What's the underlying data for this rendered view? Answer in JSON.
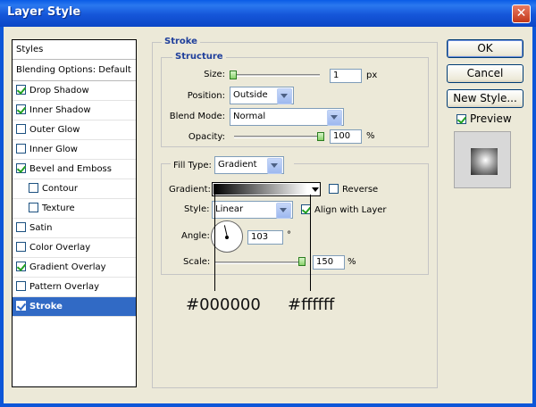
{
  "window": {
    "title": "Layer Style",
    "close_glyph": "✕"
  },
  "styles_list": {
    "header": "Styles",
    "blending": "Blending Options: Default",
    "items": [
      {
        "label": "Drop Shadow",
        "checked": true
      },
      {
        "label": "Inner Shadow",
        "checked": true
      },
      {
        "label": "Outer Glow",
        "checked": false
      },
      {
        "label": "Inner Glow",
        "checked": false
      },
      {
        "label": "Bevel and Emboss",
        "checked": true
      },
      {
        "label": "Contour",
        "checked": false
      },
      {
        "label": "Texture",
        "checked": false
      },
      {
        "label": "Satin",
        "checked": false
      },
      {
        "label": "Color Overlay",
        "checked": false
      },
      {
        "label": "Gradient Overlay",
        "checked": true
      },
      {
        "label": "Pattern Overlay",
        "checked": false
      },
      {
        "label": "Stroke",
        "checked": true
      }
    ]
  },
  "stroke": {
    "section_title": "Stroke",
    "structure_title": "Structure",
    "size_label": "Size:",
    "size_value": "1",
    "size_unit": "px",
    "position_label": "Position:",
    "position_value": "Outside",
    "blend_label": "Blend Mode:",
    "blend_value": "Normal",
    "opacity_label": "Opacity:",
    "opacity_value": "100",
    "opacity_unit": "%",
    "fill_type_label": "Fill Type:",
    "fill_type_value": "Gradient",
    "gradient_label": "Gradient:",
    "reverse_label": "Reverse",
    "reverse_checked": false,
    "style_label": "Style:",
    "style_value": "Linear",
    "align_label": "Align with Layer",
    "align_checked": true,
    "angle_label": "Angle:",
    "angle_value": "103",
    "angle_unit": "°",
    "scale_label": "Scale:",
    "scale_value": "150",
    "scale_unit": "%"
  },
  "buttons": {
    "ok": "OK",
    "cancel": "Cancel",
    "new_style": "New Style...",
    "preview": "Preview",
    "preview_checked": true
  },
  "annotations": {
    "left": "#000000",
    "right": "#ffffff"
  },
  "colors": {
    "title_bar": "#0a5ce6",
    "selection": "#316ac5",
    "section_title": "#1f3f9b"
  }
}
